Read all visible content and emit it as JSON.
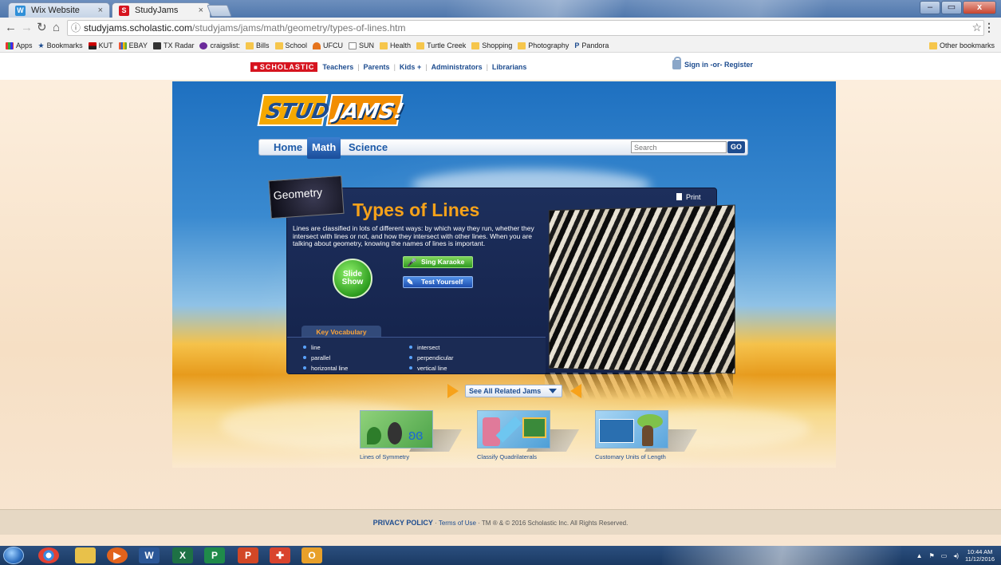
{
  "browser": {
    "tabs": [
      {
        "title": "Wix Website Editor",
        "favicon": "wix-icon",
        "active": false
      },
      {
        "title": "StudyJams",
        "favicon": "scholastic-icon",
        "active": true
      }
    ],
    "tab_close": "×",
    "window_buttons": [
      "–",
      "▭",
      "x"
    ],
    "url_host": "studyjams.scholastic.com",
    "url_path": "/studyjams/jams/math/geometry/types-of-lines.htm",
    "bookmarks": [
      {
        "label": "Apps",
        "icon": "apps-icon"
      },
      {
        "label": "Bookmarks",
        "icon": "star-icon"
      },
      {
        "label": "KUT",
        "icon": "kut-icon"
      },
      {
        "label": "EBAY",
        "icon": "ebay-icon"
      },
      {
        "label": "TX Radar",
        "icon": "radar-icon"
      },
      {
        "label": "craigslist:",
        "icon": "peace-icon"
      },
      {
        "label": "Bills",
        "icon": "folder-icon"
      },
      {
        "label": "School",
        "icon": "folder-icon"
      },
      {
        "label": "UFCU",
        "icon": "ufcu-icon"
      },
      {
        "label": "SUN",
        "icon": "page-icon"
      },
      {
        "label": "Health",
        "icon": "folder-icon"
      },
      {
        "label": "Turtle Creek",
        "icon": "folder-icon"
      },
      {
        "label": "Shopping",
        "icon": "folder-icon"
      },
      {
        "label": "Photography",
        "icon": "folder-icon"
      },
      {
        "label": "Pandora",
        "icon": "pandora-icon"
      }
    ],
    "other_bookmarks": "Other bookmarks"
  },
  "scholastic_bar": {
    "logo": "SCHOLASTIC",
    "links": [
      "Teachers",
      "Parents",
      "Kids",
      "Administrators",
      "Librarians"
    ],
    "kids_caret": "+",
    "signin": "Sign in -or- Register"
  },
  "site": {
    "logo_left": "STUDY",
    "logo_right": "JAMS!",
    "nav": [
      "Home",
      "Math",
      "Science"
    ],
    "active_nav": "Math",
    "search_placeholder": "Search",
    "go": "GO"
  },
  "jam": {
    "category": "Geometry",
    "title": "Types of Lines",
    "print": "Print",
    "description": "Lines are classified in lots of different ways: by which way they run, whether they intersect with lines or not, and how they intersect with other lines. When you are talking about geometry, knowing the names of lines is important.",
    "slideshow": "Slide Show",
    "sing_karaoke": "Sing Karaoke",
    "test_yourself": "Test Yourself",
    "vocab_title": "Key Vocabulary",
    "vocab": [
      "line",
      "parallel",
      "horizontal line",
      "intersect",
      "perpendicular",
      "vertical line"
    ]
  },
  "related": {
    "label": "See All Related Jams",
    "items": [
      "Lines of Symmetry",
      "Classify Quadrilaterals",
      "Customary Units of Length"
    ]
  },
  "footer": {
    "privacy": "PRIVACY POLICY",
    "terms": "Terms of Use",
    "copyright": "TM ® & © 2016 Scholastic Inc. All Rights Reserved."
  },
  "taskbar": {
    "time": "10:44 AM",
    "date": "11/12/2016"
  }
}
